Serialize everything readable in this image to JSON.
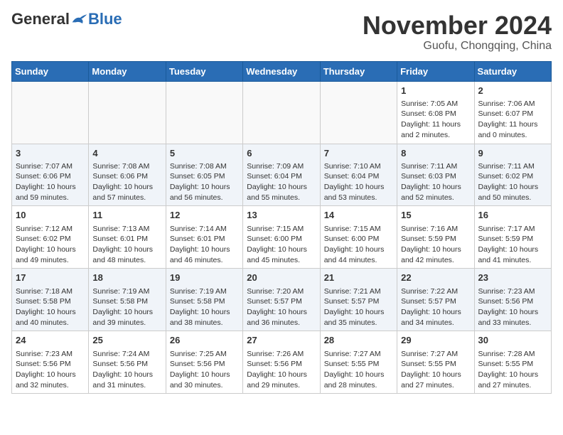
{
  "header": {
    "logo_general": "General",
    "logo_blue": "Blue",
    "month_title": "November 2024",
    "location": "Guofu, Chongqing, China"
  },
  "calendar": {
    "days_of_week": [
      "Sunday",
      "Monday",
      "Tuesday",
      "Wednesday",
      "Thursday",
      "Friday",
      "Saturday"
    ],
    "weeks": [
      [
        {
          "day": "",
          "info": ""
        },
        {
          "day": "",
          "info": ""
        },
        {
          "day": "",
          "info": ""
        },
        {
          "day": "",
          "info": ""
        },
        {
          "day": "",
          "info": ""
        },
        {
          "day": "1",
          "info": "Sunrise: 7:05 AM\nSunset: 6:08 PM\nDaylight: 11 hours and 2 minutes."
        },
        {
          "day": "2",
          "info": "Sunrise: 7:06 AM\nSunset: 6:07 PM\nDaylight: 11 hours and 0 minutes."
        }
      ],
      [
        {
          "day": "3",
          "info": "Sunrise: 7:07 AM\nSunset: 6:06 PM\nDaylight: 10 hours and 59 minutes."
        },
        {
          "day": "4",
          "info": "Sunrise: 7:08 AM\nSunset: 6:06 PM\nDaylight: 10 hours and 57 minutes."
        },
        {
          "day": "5",
          "info": "Sunrise: 7:08 AM\nSunset: 6:05 PM\nDaylight: 10 hours and 56 minutes."
        },
        {
          "day": "6",
          "info": "Sunrise: 7:09 AM\nSunset: 6:04 PM\nDaylight: 10 hours and 55 minutes."
        },
        {
          "day": "7",
          "info": "Sunrise: 7:10 AM\nSunset: 6:04 PM\nDaylight: 10 hours and 53 minutes."
        },
        {
          "day": "8",
          "info": "Sunrise: 7:11 AM\nSunset: 6:03 PM\nDaylight: 10 hours and 52 minutes."
        },
        {
          "day": "9",
          "info": "Sunrise: 7:11 AM\nSunset: 6:02 PM\nDaylight: 10 hours and 50 minutes."
        }
      ],
      [
        {
          "day": "10",
          "info": "Sunrise: 7:12 AM\nSunset: 6:02 PM\nDaylight: 10 hours and 49 minutes."
        },
        {
          "day": "11",
          "info": "Sunrise: 7:13 AM\nSunset: 6:01 PM\nDaylight: 10 hours and 48 minutes."
        },
        {
          "day": "12",
          "info": "Sunrise: 7:14 AM\nSunset: 6:01 PM\nDaylight: 10 hours and 46 minutes."
        },
        {
          "day": "13",
          "info": "Sunrise: 7:15 AM\nSunset: 6:00 PM\nDaylight: 10 hours and 45 minutes."
        },
        {
          "day": "14",
          "info": "Sunrise: 7:15 AM\nSunset: 6:00 PM\nDaylight: 10 hours and 44 minutes."
        },
        {
          "day": "15",
          "info": "Sunrise: 7:16 AM\nSunset: 5:59 PM\nDaylight: 10 hours and 42 minutes."
        },
        {
          "day": "16",
          "info": "Sunrise: 7:17 AM\nSunset: 5:59 PM\nDaylight: 10 hours and 41 minutes."
        }
      ],
      [
        {
          "day": "17",
          "info": "Sunrise: 7:18 AM\nSunset: 5:58 PM\nDaylight: 10 hours and 40 minutes."
        },
        {
          "day": "18",
          "info": "Sunrise: 7:19 AM\nSunset: 5:58 PM\nDaylight: 10 hours and 39 minutes."
        },
        {
          "day": "19",
          "info": "Sunrise: 7:19 AM\nSunset: 5:58 PM\nDaylight: 10 hours and 38 minutes."
        },
        {
          "day": "20",
          "info": "Sunrise: 7:20 AM\nSunset: 5:57 PM\nDaylight: 10 hours and 36 minutes."
        },
        {
          "day": "21",
          "info": "Sunrise: 7:21 AM\nSunset: 5:57 PM\nDaylight: 10 hours and 35 minutes."
        },
        {
          "day": "22",
          "info": "Sunrise: 7:22 AM\nSunset: 5:57 PM\nDaylight: 10 hours and 34 minutes."
        },
        {
          "day": "23",
          "info": "Sunrise: 7:23 AM\nSunset: 5:56 PM\nDaylight: 10 hours and 33 minutes."
        }
      ],
      [
        {
          "day": "24",
          "info": "Sunrise: 7:23 AM\nSunset: 5:56 PM\nDaylight: 10 hours and 32 minutes."
        },
        {
          "day": "25",
          "info": "Sunrise: 7:24 AM\nSunset: 5:56 PM\nDaylight: 10 hours and 31 minutes."
        },
        {
          "day": "26",
          "info": "Sunrise: 7:25 AM\nSunset: 5:56 PM\nDaylight: 10 hours and 30 minutes."
        },
        {
          "day": "27",
          "info": "Sunrise: 7:26 AM\nSunset: 5:56 PM\nDaylight: 10 hours and 29 minutes."
        },
        {
          "day": "28",
          "info": "Sunrise: 7:27 AM\nSunset: 5:55 PM\nDaylight: 10 hours and 28 minutes."
        },
        {
          "day": "29",
          "info": "Sunrise: 7:27 AM\nSunset: 5:55 PM\nDaylight: 10 hours and 27 minutes."
        },
        {
          "day": "30",
          "info": "Sunrise: 7:28 AM\nSunset: 5:55 PM\nDaylight: 10 hours and 27 minutes."
        }
      ]
    ]
  }
}
